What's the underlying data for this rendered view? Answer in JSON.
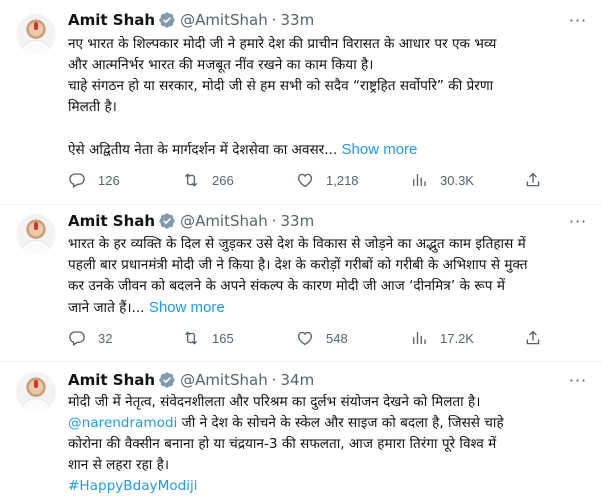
{
  "tweets": [
    {
      "author": "Amit Shah",
      "handle": "@AmitShah",
      "time": "33m",
      "lines": [
        "नए भारत के शिल्पकार मोदी जी ने हमारे देश की प्राचीन विरासत के आधार पर एक भव्य",
        "और आत्मनिर्भर भारत की मजबूत नींव रखने का काम किया है।",
        "चाहे संगठन हो या सरकार, मोदी जी से हम सभी को सदैव “राष्ट्रहित सर्वोपरि” की प्रेरणा",
        "मिलती है।",
        "ऐसे अद्वितीय नेता के मार्गदर्शन में देशसेवा का अवसर..."
      ],
      "show_more": "Show more",
      "replies": "126",
      "retweets": "266",
      "likes": "1,218",
      "views": "30.3K"
    },
    {
      "author": "Amit Shah",
      "handle": "@AmitShah",
      "time": "33m",
      "lines": [
        "भारत के हर व्यक्ति के दिल से जुड़कर उसे देश के विकास से जोड़ने का अद्भुत काम इतिहास में",
        "पहली बार प्रधानमंत्री मोदी जी ने किया है। देश के करोड़ों गरीबों को गरीबी के अभिशाप से मुक्त",
        "कर उनके जीवन को बदलने के अपने संकल्प के कारण मोदी जी आज ‘दीनमित्र’ के रूप में",
        "जाने जाते हैं।..."
      ],
      "show_more": "Show more",
      "replies": "32",
      "retweets": "165",
      "likes": "548",
      "views": "17.2K"
    },
    {
      "author": "Amit Shah",
      "handle": "@AmitShah",
      "time": "34m",
      "lines": [
        "मोदी जी में नेतृत्व, संवेदनशीलता और परिश्रम का दुर्लभ संयोजन देखने को मिलता है।",
        "जी ने देश के सोचने के स्केल और साइज को बदला है, जिससे चाहे",
        "कोरोना की वैक्सीन बनाना हो या चंद्रयान-3 की सफलता, आज हमारा तिरंगा पूरे विश्व में",
        "शान से लहरा रहा है।"
      ],
      "mention": "@narendramodi",
      "hashtag": "#HappyBdayModiji"
    }
  ],
  "icons": {
    "verified": "verified-badge-icon",
    "more": "more-options-icon",
    "reply": "reply-icon",
    "retweet": "retweet-icon",
    "like": "like-heart-icon",
    "views": "views-bar-chart-icon",
    "share": "share-icon"
  },
  "colors": {
    "accent": "#1d9bf0",
    "secondary_text": "#536471",
    "primary_text": "#0f1419",
    "divider": "#eff3f4"
  }
}
